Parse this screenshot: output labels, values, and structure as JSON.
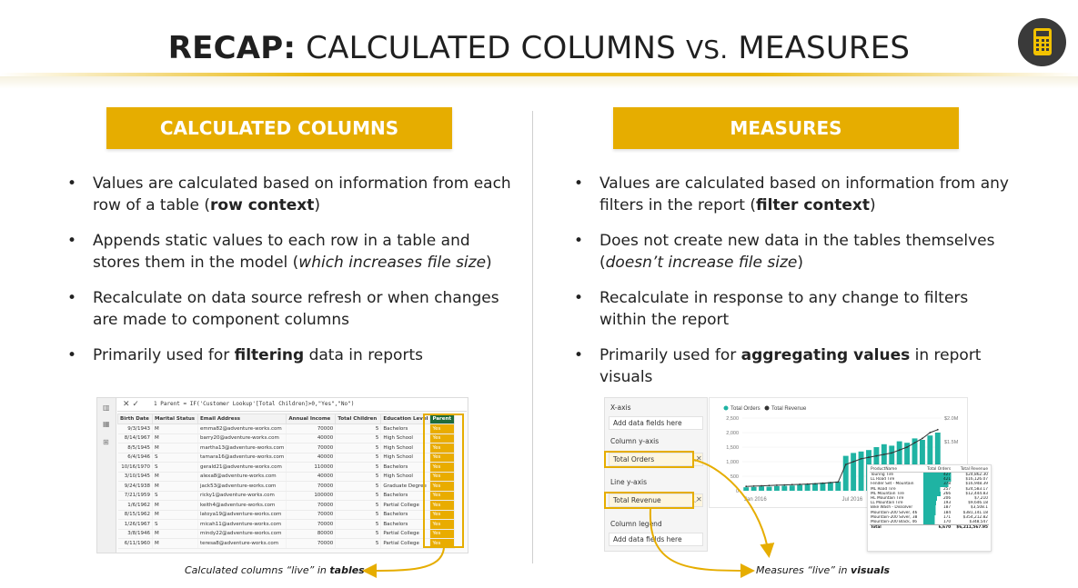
{
  "header": {
    "title_bold": "RECAP:",
    "title_part1": " CALCULATED COLUMNS ",
    "title_vs": "VS.",
    "title_part2": " MEASURES",
    "badge_icon": "calculator-icon"
  },
  "colors": {
    "accent": "#e6ad00",
    "chart_teal": "#1fb3a3",
    "parent_header": "#1f6b3a"
  },
  "left": {
    "heading": "CALCULATED COLUMNS",
    "bullets": [
      {
        "pre": "Values are calculated based on information from each row of a table (",
        "bold": "row context",
        "post": ")"
      },
      {
        "pre": "Appends static values to each row in a table and stores them in the model (",
        "italic": "which increases file size",
        "post": ")"
      },
      {
        "pre": "Recalculate on data source refresh or when changes are made to component columns"
      },
      {
        "pre": "Primarily used for ",
        "bold": "filtering",
        "post": " data in reports"
      }
    ],
    "caption_pre": "Calculated columns “live” in ",
    "caption_bold": "tables"
  },
  "right": {
    "heading": "MEASURES",
    "bullets": [
      {
        "pre": "Values are calculated based on information from any filters in the report (",
        "bold": "filter context",
        "post": ")"
      },
      {
        "pre": "Does not create new data in the tables themselves (",
        "italic": "doesn’t increase file size",
        "post": ")"
      },
      {
        "pre": "Recalculate in response to any change to filters within the report"
      },
      {
        "pre": "Primarily used for ",
        "bold": "aggregating values",
        "post": " in report visuals"
      }
    ],
    "caption_pre": "Measures “live” in ",
    "caption_bold": "visuals"
  },
  "table_shot": {
    "formula": "1  Parent = IF('Customer Lookup'[Total Children]>0,\"Yes\",\"No\")",
    "columns": [
      "Birth Date",
      "Marital Status",
      "Email Address",
      "Annual Income",
      "Total Children",
      "Education Level",
      "Parent"
    ],
    "rows": [
      [
        "9/3/1943",
        "M",
        "emma82@adventure-works.com",
        "70000",
        "5",
        "Bachelors",
        "Yes"
      ],
      [
        "8/14/1967",
        "M",
        "barry20@adventure-works.com",
        "40000",
        "5",
        "High School",
        "Yes"
      ],
      [
        "8/5/1945",
        "M",
        "martha13@adventure-works.com",
        "70000",
        "5",
        "High School",
        "Yes"
      ],
      [
        "6/4/1946",
        "S",
        "tamara16@adventure-works.com",
        "40000",
        "5",
        "High School",
        "Yes"
      ],
      [
        "10/16/1970",
        "S",
        "gerald21@adventure-works.com",
        "110000",
        "5",
        "Bachelors",
        "Yes"
      ],
      [
        "3/10/1945",
        "M",
        "alexa8@adventure-works.com",
        "40000",
        "5",
        "High School",
        "Yes"
      ],
      [
        "9/24/1938",
        "M",
        "jack53@adventure-works.com",
        "70000",
        "5",
        "Graduate Degree",
        "Yes"
      ],
      [
        "7/21/1959",
        "S",
        "ricky1@adventure-works.com",
        "100000",
        "5",
        "Bachelors",
        "Yes"
      ],
      [
        "1/6/1962",
        "M",
        "keith4@adventure-works.com",
        "70000",
        "5",
        "Partial College",
        "Yes"
      ],
      [
        "8/15/1962",
        "M",
        "latoya19@adventure-works.com",
        "70000",
        "5",
        "Bachelors",
        "Yes"
      ],
      [
        "1/26/1967",
        "S",
        "micah11@adventure-works.com",
        "70000",
        "5",
        "Bachelors",
        "Yes"
      ],
      [
        "3/8/1946",
        "M",
        "mindy22@adventure-works.com",
        "80000",
        "5",
        "Partial College",
        "Yes"
      ],
      [
        "6/11/1960",
        "M",
        "teresa8@adventure-works.com",
        "70000",
        "5",
        "Partial College",
        "Yes"
      ]
    ]
  },
  "fields_pane": {
    "xaxis_label": "X-axis",
    "xaxis_placeholder": "Add data fields here",
    "yaxis_label": "Column y-axis",
    "yaxis_value": "Total Orders",
    "liney_label": "Line y-axis",
    "liney_value": "Total Revenue",
    "legend_label": "Column legend",
    "legend_placeholder": "Add data fields here"
  },
  "chart_data": {
    "type": "bar",
    "legend": [
      "Total Orders",
      "Total Revenue"
    ],
    "y_ticks": [
      "2,500",
      "2,000",
      "1,500",
      "1,000",
      "500",
      "0"
    ],
    "y2_ticks": [
      "$2.0M",
      "$1.5M"
    ],
    "x_ticks": [
      "Jan 2016",
      "Jul 2016"
    ],
    "ylim": [
      0,
      2500
    ],
    "series": [
      {
        "name": "Total Orders",
        "values": [
          120,
          130,
          150,
          140,
          160,
          170,
          180,
          200,
          220,
          260,
          280,
          300,
          320,
          1200,
          1300,
          1350,
          1400,
          1500,
          1600,
          1550,
          1700,
          1650,
          1800,
          1750,
          1900,
          2000
        ]
      },
      {
        "name": "Total Revenue",
        "values": [
          150,
          160,
          170,
          180,
          190,
          200,
          210,
          220,
          230,
          240,
          260,
          280,
          300,
          900,
          1000,
          1100,
          1150,
          1200,
          1250,
          1300,
          1400,
          1500,
          1650,
          1800,
          2000,
          2100
        ]
      }
    ]
  },
  "matrix": {
    "headers": [
      "ProductName",
      "Total Orders",
      "Total Revenue"
    ],
    "rows": [
      [
        "Touring Tire",
        "427",
        "$24,862.30"
      ],
      [
        "LL Road Tire",
        "421",
        "$16,126.07"
      ],
      [
        "Fender Set - Mountain",
        "378",
        "$16,948.39"
      ],
      [
        "ML Road Tire",
        "257",
        "$24,583.17"
      ],
      [
        "ML Mountain Tire",
        "266",
        "$12,444.83"
      ],
      [
        "HL Mountain Tire",
        "206",
        "$7,210"
      ],
      [
        "LL Mountain Tire",
        "193",
        "$9,646.18"
      ],
      [
        "Bike Wash - Dissolver",
        "187",
        "$3,508.1"
      ],
      [
        "Mountain-200 Silver, 46",
        "184",
        "$381,141.18"
      ],
      [
        "Mountain-200 Silver, 38",
        "171",
        "$354,212.82"
      ],
      [
        "Mountain-200 Black, 46",
        "170",
        "$348,547"
      ]
    ],
    "total": [
      "Total",
      "6,670",
      "$6,211,567.95"
    ]
  }
}
